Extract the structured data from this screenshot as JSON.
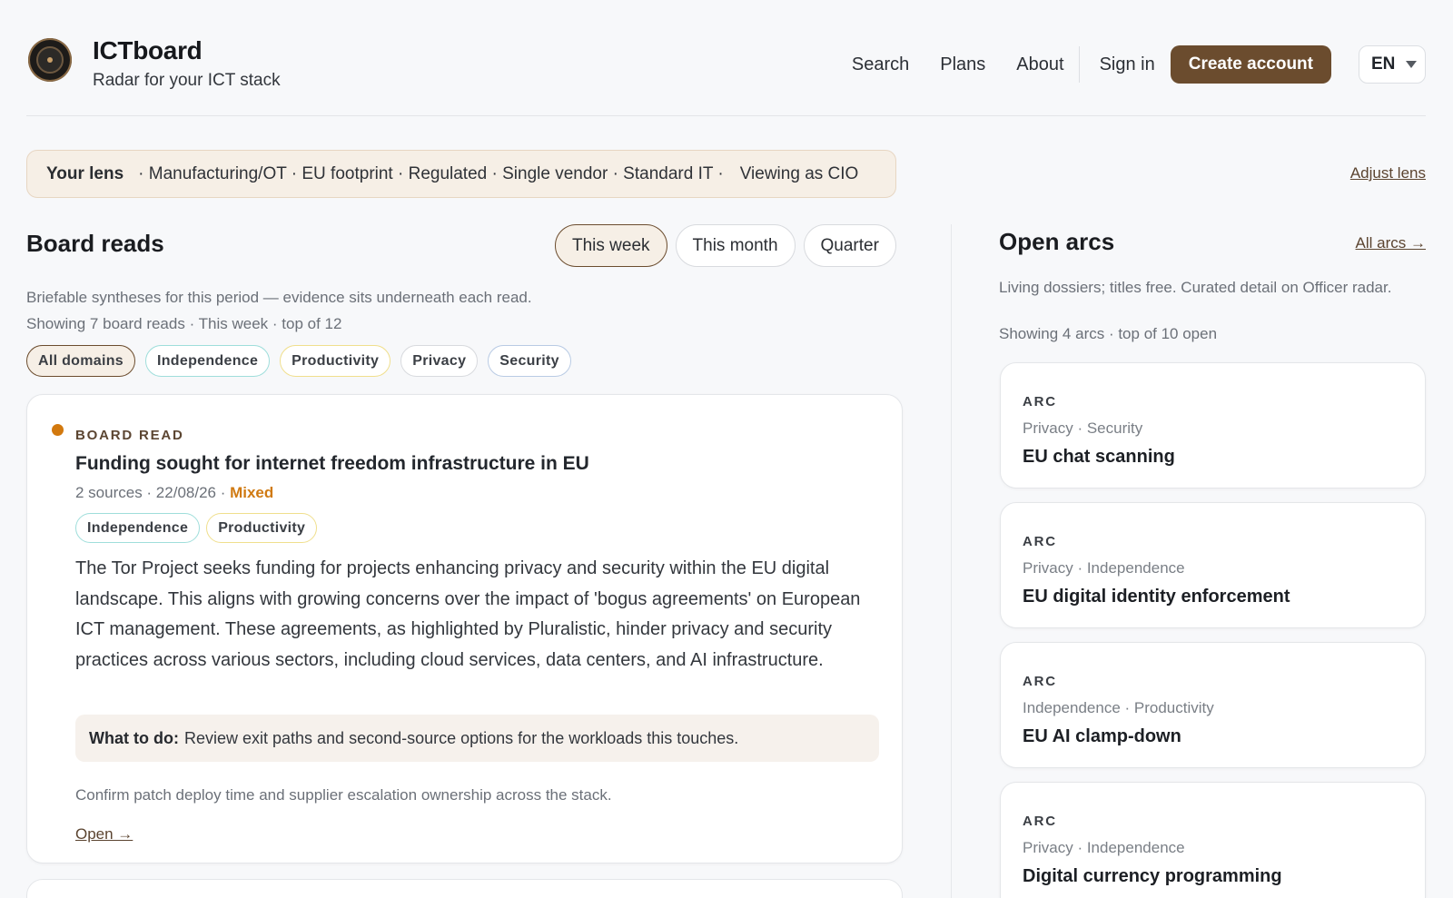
{
  "brand": {
    "name": "ICTboard",
    "tagline": "Radar for your ICT stack"
  },
  "nav": {
    "search": "Search",
    "plans": "Plans",
    "about": "About",
    "sign_in": "Sign in",
    "create_account": "Create account",
    "language": "EN"
  },
  "lens": {
    "label": "Your lens",
    "items": "· Manufacturing/OT · EU footprint · Regulated · Single vendor · Standard IT ·",
    "viewing": "Viewing as CIO",
    "adjust": "Adjust lens"
  },
  "board_reads": {
    "title": "Board reads",
    "periods": [
      "This week",
      "This month",
      "Quarter"
    ],
    "active_period": "This week",
    "description": "Briefable syntheses for this period — evidence sits underneath each read.",
    "count": "Showing 7 board reads · This week · top of 12",
    "filters": [
      "All domains",
      "Independence",
      "Productivity",
      "Privacy",
      "Security"
    ]
  },
  "card": {
    "kicker": "BOARD READ",
    "title": "Funding sought for internet freedom infrastructure in EU",
    "meta": "2 sources · 22/08/26 · ",
    "sentiment": "Mixed",
    "tags": [
      "Independence",
      "Productivity"
    ],
    "body": "The Tor Project seeks funding for projects enhancing privacy and security within the EU digital landscape. This aligns with growing concerns over the impact of 'bogus agreements' on European ICT management. These agreements, as highlighted by Pluralistic, hinder privacy and security practices across various sectors, including cloud services, data centers, and AI infrastructure.",
    "todo_label": "What to do:",
    "todo_text": "Review exit paths and second-source options for the workloads this touches.",
    "confirm": "Confirm patch deploy time and supplier escalation ownership across the stack.",
    "open": "Open →"
  },
  "arcs": {
    "title": "Open arcs",
    "all_link": "All arcs →",
    "description": "Living dossiers; titles free. Curated detail on Officer radar.",
    "count": "Showing 4 arcs · top of 10 open",
    "items": [
      {
        "kicker": "ARC",
        "domains": "Privacy · Security",
        "title": "EU chat scanning"
      },
      {
        "kicker": "ARC",
        "domains": "Privacy · Independence",
        "title": "EU digital identity enforcement"
      },
      {
        "kicker": "ARC",
        "domains": "Independence · Productivity",
        "title": "EU AI clamp-down"
      },
      {
        "kicker": "ARC",
        "domains": "Privacy · Independence",
        "title": "Digital currency programming"
      }
    ]
  },
  "colors": {
    "accent": "#6b4c2e",
    "mixed": "#d07a12",
    "lens_bg": "#f6efe6"
  }
}
